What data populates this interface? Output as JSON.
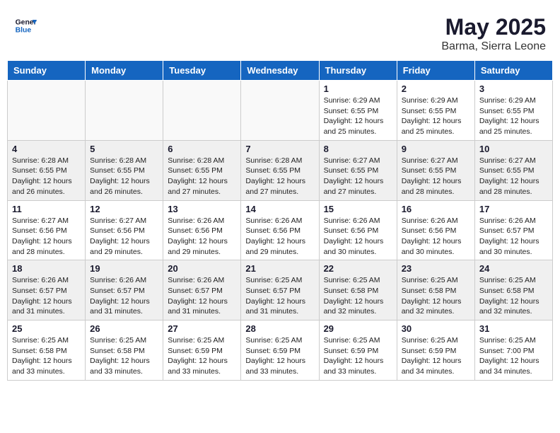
{
  "header": {
    "logo_line1": "General",
    "logo_line2": "Blue",
    "month": "May 2025",
    "location": "Barma, Sierra Leone"
  },
  "weekdays": [
    "Sunday",
    "Monday",
    "Tuesday",
    "Wednesday",
    "Thursday",
    "Friday",
    "Saturday"
  ],
  "weeks": [
    [
      {
        "day": "",
        "info": "",
        "empty": true
      },
      {
        "day": "",
        "info": "",
        "empty": true
      },
      {
        "day": "",
        "info": "",
        "empty": true
      },
      {
        "day": "",
        "info": "",
        "empty": true
      },
      {
        "day": "1",
        "info": "Sunrise: 6:29 AM\nSunset: 6:55 PM\nDaylight: 12 hours\nand 25 minutes."
      },
      {
        "day": "2",
        "info": "Sunrise: 6:29 AM\nSunset: 6:55 PM\nDaylight: 12 hours\nand 25 minutes."
      },
      {
        "day": "3",
        "info": "Sunrise: 6:29 AM\nSunset: 6:55 PM\nDaylight: 12 hours\nand 25 minutes."
      }
    ],
    [
      {
        "day": "4",
        "info": "Sunrise: 6:28 AM\nSunset: 6:55 PM\nDaylight: 12 hours\nand 26 minutes.",
        "shaded": true
      },
      {
        "day": "5",
        "info": "Sunrise: 6:28 AM\nSunset: 6:55 PM\nDaylight: 12 hours\nand 26 minutes.",
        "shaded": true
      },
      {
        "day": "6",
        "info": "Sunrise: 6:28 AM\nSunset: 6:55 PM\nDaylight: 12 hours\nand 27 minutes.",
        "shaded": true
      },
      {
        "day": "7",
        "info": "Sunrise: 6:28 AM\nSunset: 6:55 PM\nDaylight: 12 hours\nand 27 minutes.",
        "shaded": true
      },
      {
        "day": "8",
        "info": "Sunrise: 6:27 AM\nSunset: 6:55 PM\nDaylight: 12 hours\nand 27 minutes.",
        "shaded": true
      },
      {
        "day": "9",
        "info": "Sunrise: 6:27 AM\nSunset: 6:55 PM\nDaylight: 12 hours\nand 28 minutes.",
        "shaded": true
      },
      {
        "day": "10",
        "info": "Sunrise: 6:27 AM\nSunset: 6:55 PM\nDaylight: 12 hours\nand 28 minutes.",
        "shaded": true
      }
    ],
    [
      {
        "day": "11",
        "info": "Sunrise: 6:27 AM\nSunset: 6:56 PM\nDaylight: 12 hours\nand 28 minutes."
      },
      {
        "day": "12",
        "info": "Sunrise: 6:27 AM\nSunset: 6:56 PM\nDaylight: 12 hours\nand 29 minutes."
      },
      {
        "day": "13",
        "info": "Sunrise: 6:26 AM\nSunset: 6:56 PM\nDaylight: 12 hours\nand 29 minutes."
      },
      {
        "day": "14",
        "info": "Sunrise: 6:26 AM\nSunset: 6:56 PM\nDaylight: 12 hours\nand 29 minutes."
      },
      {
        "day": "15",
        "info": "Sunrise: 6:26 AM\nSunset: 6:56 PM\nDaylight: 12 hours\nand 30 minutes."
      },
      {
        "day": "16",
        "info": "Sunrise: 6:26 AM\nSunset: 6:56 PM\nDaylight: 12 hours\nand 30 minutes."
      },
      {
        "day": "17",
        "info": "Sunrise: 6:26 AM\nSunset: 6:57 PM\nDaylight: 12 hours\nand 30 minutes."
      }
    ],
    [
      {
        "day": "18",
        "info": "Sunrise: 6:26 AM\nSunset: 6:57 PM\nDaylight: 12 hours\nand 31 minutes.",
        "shaded": true
      },
      {
        "day": "19",
        "info": "Sunrise: 6:26 AM\nSunset: 6:57 PM\nDaylight: 12 hours\nand 31 minutes.",
        "shaded": true
      },
      {
        "day": "20",
        "info": "Sunrise: 6:26 AM\nSunset: 6:57 PM\nDaylight: 12 hours\nand 31 minutes.",
        "shaded": true
      },
      {
        "day": "21",
        "info": "Sunrise: 6:25 AM\nSunset: 6:57 PM\nDaylight: 12 hours\nand 31 minutes.",
        "shaded": true
      },
      {
        "day": "22",
        "info": "Sunrise: 6:25 AM\nSunset: 6:58 PM\nDaylight: 12 hours\nand 32 minutes.",
        "shaded": true
      },
      {
        "day": "23",
        "info": "Sunrise: 6:25 AM\nSunset: 6:58 PM\nDaylight: 12 hours\nand 32 minutes.",
        "shaded": true
      },
      {
        "day": "24",
        "info": "Sunrise: 6:25 AM\nSunset: 6:58 PM\nDaylight: 12 hours\nand 32 minutes.",
        "shaded": true
      }
    ],
    [
      {
        "day": "25",
        "info": "Sunrise: 6:25 AM\nSunset: 6:58 PM\nDaylight: 12 hours\nand 33 minutes."
      },
      {
        "day": "26",
        "info": "Sunrise: 6:25 AM\nSunset: 6:58 PM\nDaylight: 12 hours\nand 33 minutes."
      },
      {
        "day": "27",
        "info": "Sunrise: 6:25 AM\nSunset: 6:59 PM\nDaylight: 12 hours\nand 33 minutes."
      },
      {
        "day": "28",
        "info": "Sunrise: 6:25 AM\nSunset: 6:59 PM\nDaylight: 12 hours\nand 33 minutes."
      },
      {
        "day": "29",
        "info": "Sunrise: 6:25 AM\nSunset: 6:59 PM\nDaylight: 12 hours\nand 33 minutes."
      },
      {
        "day": "30",
        "info": "Sunrise: 6:25 AM\nSunset: 6:59 PM\nDaylight: 12 hours\nand 34 minutes."
      },
      {
        "day": "31",
        "info": "Sunrise: 6:25 AM\nSunset: 7:00 PM\nDaylight: 12 hours\nand 34 minutes."
      }
    ]
  ]
}
